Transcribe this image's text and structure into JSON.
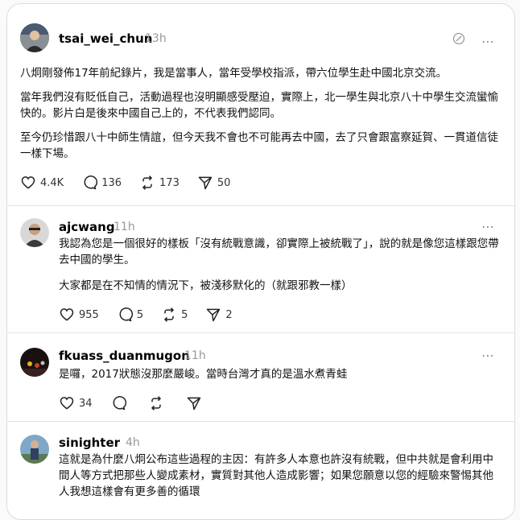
{
  "posts": [
    {
      "username": "tsai_wei_chun",
      "time": "13h",
      "paragraphs": [
        "八炯剛發佈17年前紀錄片，我是當事人，當年受學校指派，帶六位學生赴中國北京交流。",
        "當年我們沒有貶低自己，活動過程也沒明顯感受壓迫，實際上，北一學生與北京八十中學生交流蠻愉快的。影片白是後來中國自己上的，不代表我們認同。",
        "至今仍珍惜跟八十中師生情誼，但今天我不會也不可能再去中國，去了只會跟富察延賀、一貫道信徒一樣下場。"
      ],
      "likes": "4.4K",
      "comments": "136",
      "reposts": "173",
      "shares": "50"
    },
    {
      "username": "ajcwang",
      "time": "11h",
      "paragraphs": [
        "我認為您是一個很好的樣板「沒有統戰意識，卻實際上被統戰了」，說的就是像您這樣跟您帶去中國的學生。",
        "大家都是在不知情的情況下，被淺移默化的（就跟邪教一樣）"
      ],
      "likes": "955",
      "comments": "5",
      "reposts": "5",
      "shares": "2"
    },
    {
      "username": "fkuass_duanmugon",
      "time": "11h",
      "paragraphs": [
        "是囉，2017狀態沒那麼嚴峻。當時台灣才真的是溫水煮青蛙"
      ],
      "likes": "34",
      "comments": "",
      "reposts": "",
      "shares": ""
    },
    {
      "username": "sinighter",
      "time": "4h",
      "paragraphs": [
        "這就是為什麼八炯公布這些過程的主因：有許多人本意也許沒有統戰，但中共就是會利用中間人等方式把那些人變成素材，實質對其他人造成影響；如果您願意以您的經驗來警惕其他人我想這樣會有更多善的循環"
      ],
      "likes": "",
      "comments": "",
      "reposts": "",
      "shares": ""
    }
  ],
  "icons": {
    "more": "⋯",
    "like": "heart-icon",
    "comment": "comment-icon",
    "repost": "repost-icon",
    "share": "share-icon",
    "edit": "edit-icon"
  }
}
